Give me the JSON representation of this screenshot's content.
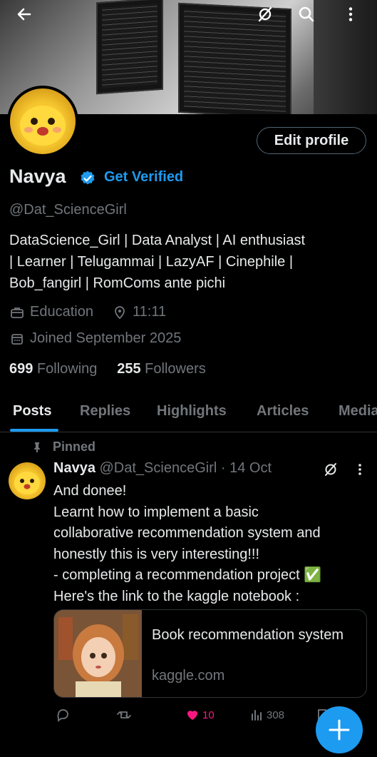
{
  "header": {
    "back_icon": "arrow-left-icon",
    "actions": [
      "hide-icon",
      "search-icon",
      "more-icon"
    ]
  },
  "profile": {
    "edit_label": "Edit profile",
    "name": "Navya",
    "get_verified": "Get Verified",
    "handle": "@Dat_ScienceGirl",
    "bio_lines": [
      "DataScience_Girl | Data Analyst | AI enthusiast",
      "| Learner | Telugammai | LazyAF | Cinephile |",
      "Bob_fangirl | RomComs ante pichi"
    ],
    "category": "Education",
    "location": "11:11",
    "joined": "Joined September 2025",
    "following_count": "699",
    "following_label": "Following",
    "followers_count": "255",
    "followers_label": "Followers"
  },
  "tabs": [
    {
      "label": "Posts",
      "active": true
    },
    {
      "label": "Replies",
      "active": false
    },
    {
      "label": "Highlights",
      "active": false
    },
    {
      "label": "Articles",
      "active": false
    },
    {
      "label": "Media",
      "active": false
    }
  ],
  "post": {
    "pinned_label": "Pinned",
    "author_name": "Navya",
    "author_handle": "@Dat_ScienceGirl · 14 Oct",
    "text_lines": [
      "And donee!",
      "Learnt how to implement a basic",
      "collaborative recommendation system and",
      "honestly this is very interesting!!!",
      "- completing a recommendation project ✅",
      "Here's the link to the kaggle notebook :"
    ],
    "card": {
      "title": "Book recommendation system",
      "domain": "kaggle.com"
    },
    "actions": {
      "likes": "10",
      "views": "308"
    }
  },
  "colors": {
    "accent": "#1d9bf0",
    "like": "#f91880",
    "background": "#000000",
    "secondary_text": "#71767b"
  }
}
